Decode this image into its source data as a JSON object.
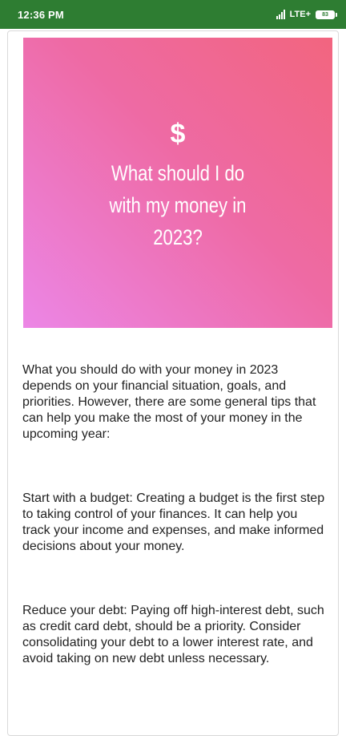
{
  "status_bar": {
    "time": "12:36 PM",
    "network": "LTE+",
    "battery": "83"
  },
  "hero": {
    "icon": "$",
    "title": "What should I do with my money in 2023?"
  },
  "article": {
    "paragraphs": [
      "What you should do with your money in 2023 depends on your financial situation, goals, and priorities. However, there are some general tips that can help you make the most of your money in the upcoming year:",
      "Start with a budget: Creating a budget is the first step to taking control of your finances. It can help you track your income and expenses, and make informed decisions about your money.",
      "Reduce your debt: Paying off high-interest debt, such as credit card debt, should be a priority. Consider consolidating your debt to a lower interest rate, and avoid taking on new debt unless necessary."
    ]
  }
}
